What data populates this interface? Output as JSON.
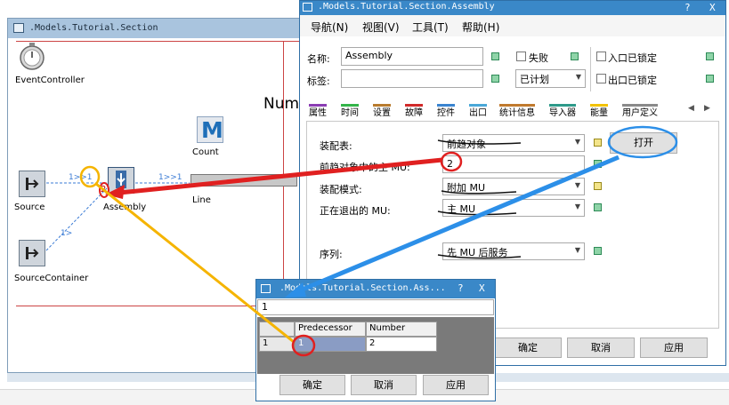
{
  "model_window": {
    "title": ".Models.Tutorial.Section",
    "objects": {
      "event_controller": "EventController",
      "count": "Count",
      "source": "Source",
      "assembly": "Assembly",
      "line": "Line",
      "source_container": "SourceContainer",
      "m_icon": "M",
      "num_label": "Num"
    },
    "connectors": {
      "a": "1>>1",
      "b": "1>>1",
      "c": "1>"
    },
    "marker_2": "2"
  },
  "dialog": {
    "title": ".Models.Tutorial.Section.Assembly",
    "help": "?",
    "close": "X",
    "menu": [
      "导航(N)",
      "视图(V)",
      "工具(T)",
      "帮助(H)"
    ],
    "name_label": "名称:",
    "name_value": "Assembly",
    "tag_label": "标签:",
    "tag_value": "",
    "failed_label": "失败",
    "planned_value": "已计划",
    "entrance_locked": "入口已锁定",
    "exit_locked": "出口已锁定",
    "tabs": [
      "属性",
      "时间",
      "设置",
      "故障",
      "控件",
      "出口",
      "统计信息",
      "导入器",
      "能量",
      "用户定义"
    ],
    "tab_colors": [
      "#8b3db3",
      "#34b54a",
      "#b87b2e",
      "#d12a2a",
      "#3a84d0",
      "#4aa8d8",
      "#c07a2e",
      "#2e9a8a",
      "#f2c200",
      "#8a8a8a"
    ],
    "assembly_table_label": "装配表:",
    "assembly_table_value": "前趋对象",
    "open_button": "打开",
    "main_mu_label": "前趋对象中的主 MU:",
    "main_mu_value": "2",
    "assembly_mode_label": "装配模式:",
    "assembly_mode_value": "附加 MU",
    "exiting_mu_label": "正在退出的 MU:",
    "exiting_mu_value": "主 MU",
    "sequence_label": "序列:",
    "sequence_value": "先 MU 后服务",
    "ok": "确定",
    "cancel": "取消",
    "apply": "应用"
  },
  "table_window": {
    "title": ".Models.Tutorial.Section.Ass...",
    "help": "?",
    "close": "X",
    "input_value": "1",
    "columns": [
      "Predecessor",
      "Number"
    ],
    "rows": [
      {
        "index": "1",
        "predecessor": "1",
        "number": "2"
      }
    ],
    "ok": "确定",
    "cancel": "取消",
    "apply": "应用"
  }
}
